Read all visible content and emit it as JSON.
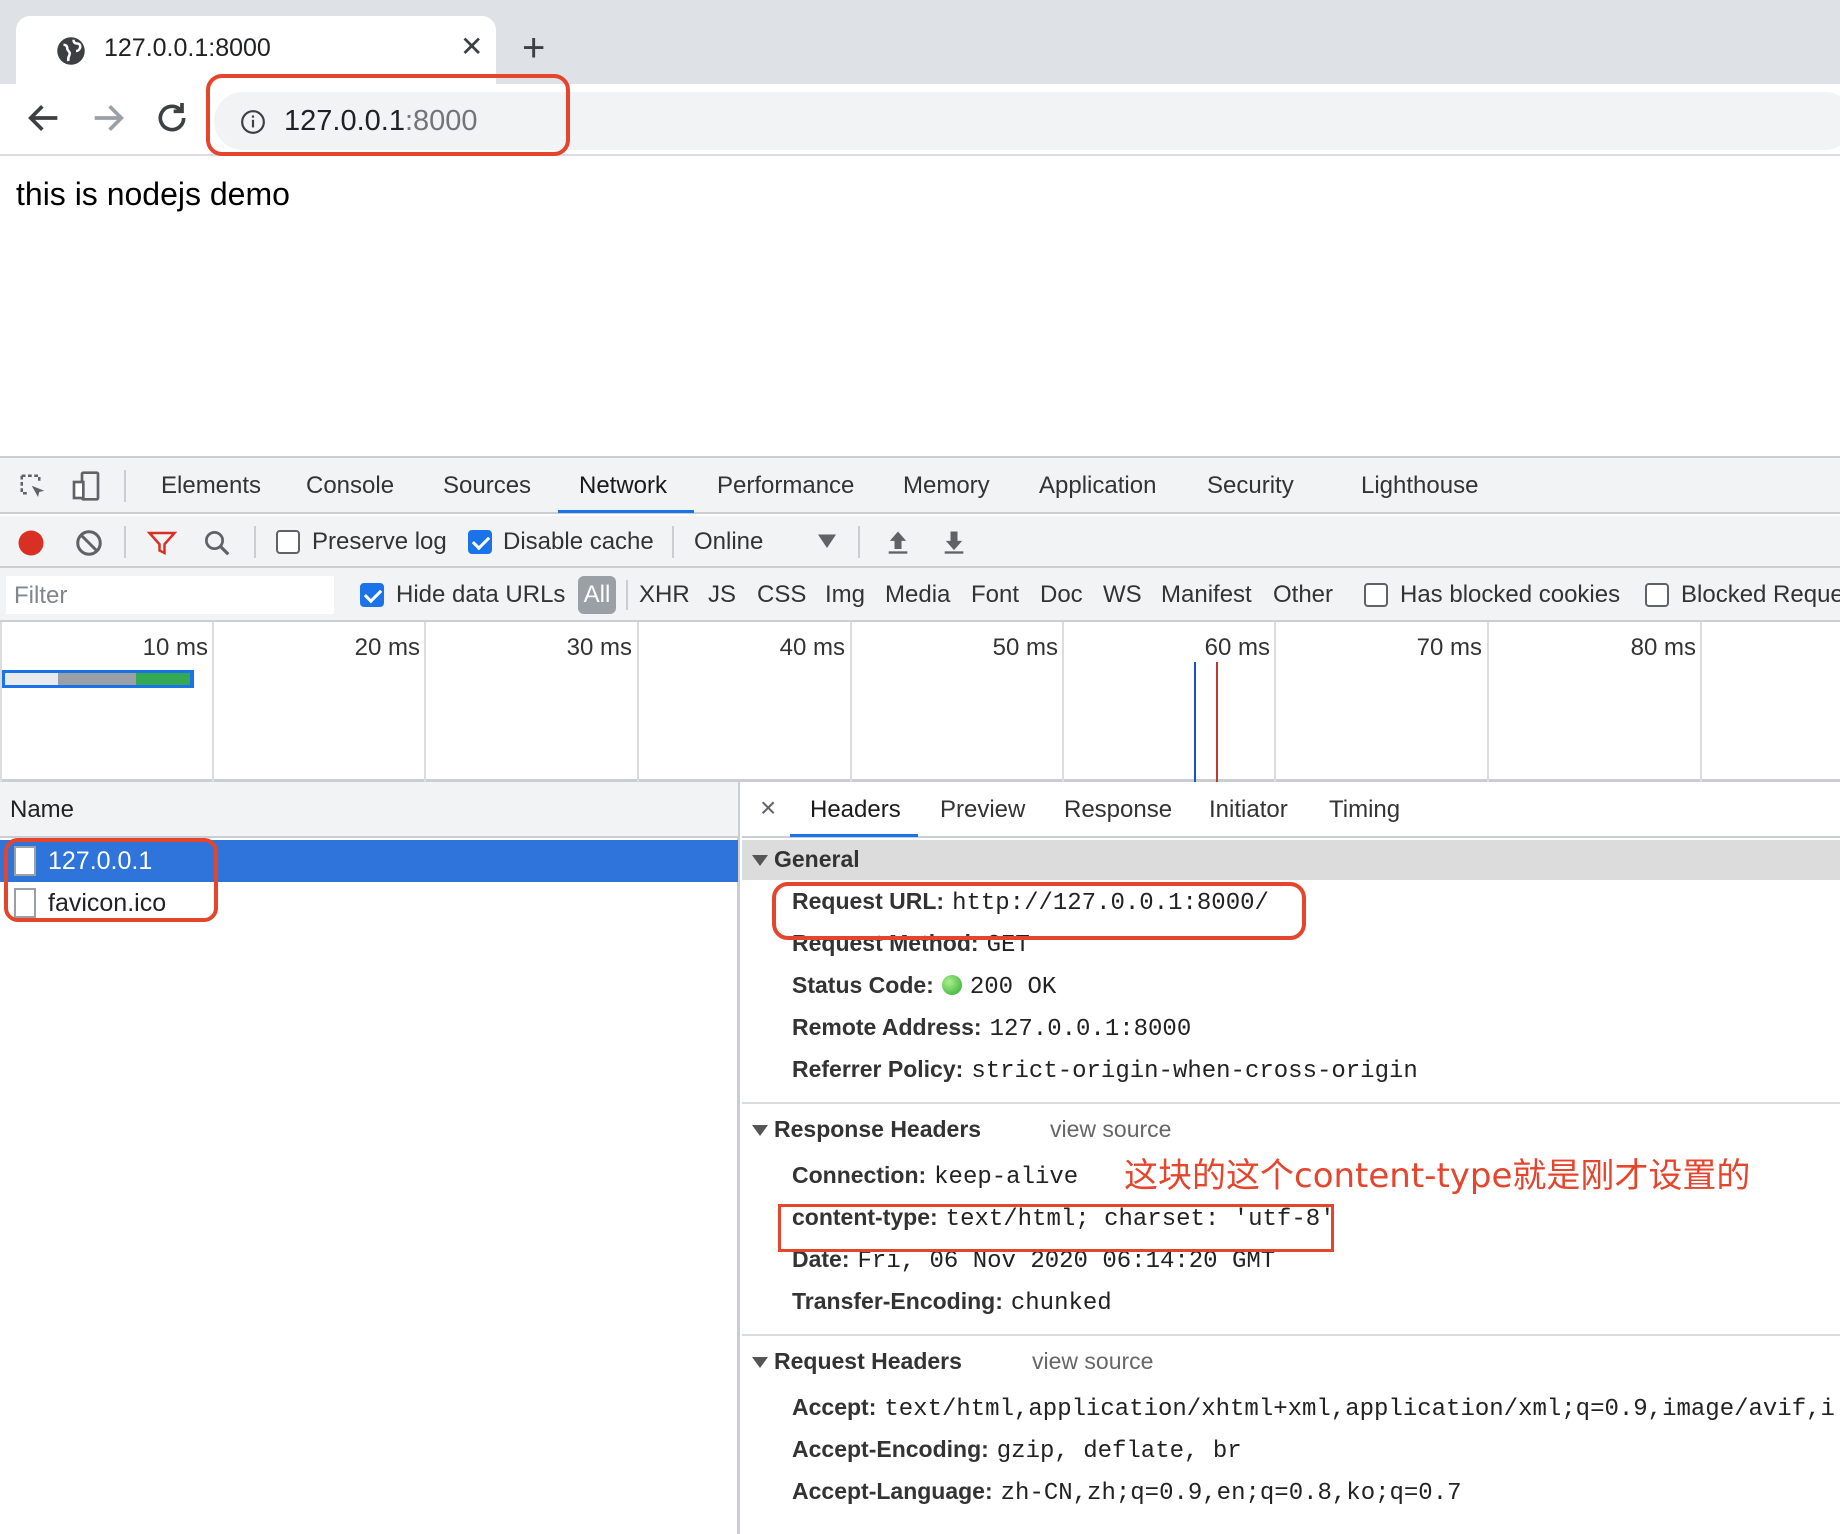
{
  "browser": {
    "tab_title": "127.0.0.1:8000",
    "url_host": "127.0.0.1",
    "url_port": ":8000"
  },
  "page": {
    "body_text": "this is nodejs demo"
  },
  "devtools": {
    "panels": [
      "Elements",
      "Console",
      "Sources",
      "Network",
      "Performance",
      "Memory",
      "Application",
      "Security",
      "Lighthouse"
    ],
    "active_panel": "Network",
    "toolbar": {
      "preserve_log": "Preserve log",
      "preserve_log_checked": false,
      "disable_cache": "Disable cache",
      "disable_cache_checked": true,
      "throttling": "Online"
    },
    "filter": {
      "placeholder": "Filter",
      "hide_data_urls": "Hide data URLs",
      "hide_data_urls_checked": true,
      "types": [
        "All",
        "XHR",
        "JS",
        "CSS",
        "Img",
        "Media",
        "Font",
        "Doc",
        "WS",
        "Manifest",
        "Other"
      ],
      "active_type": "All",
      "has_blocked_cookies": "Has blocked cookies",
      "blocked_requests": "Blocked Reque"
    },
    "timeline": {
      "ticks": [
        "10 ms",
        "20 ms",
        "30 ms",
        "40 ms",
        "50 ms",
        "60 ms",
        "70 ms",
        "80 ms"
      ],
      "colors": {
        "dom_content_loaded": "#1a4fd6",
        "load": "#c0392b",
        "bar_green": "#34a853",
        "bar_gray": "#9aa0a6"
      }
    },
    "requests": {
      "column_name": "Name",
      "rows": [
        {
          "name": "127.0.0.1",
          "selected": true
        },
        {
          "name": "favicon.ico",
          "selected": false
        }
      ]
    },
    "detail": {
      "tabs": [
        "Headers",
        "Preview",
        "Response",
        "Initiator",
        "Timing"
      ],
      "active_tab": "Headers",
      "general": {
        "title": "General",
        "rows": [
          {
            "k": "Request URL:",
            "v": "http://127.0.0.1:8000/"
          },
          {
            "k": "Request Method:",
            "v": "GET"
          },
          {
            "k": "Status Code:",
            "v": "200 OK"
          },
          {
            "k": "Remote Address:",
            "v": "127.0.0.1:8000"
          },
          {
            "k": "Referrer Policy:",
            "v": "strict-origin-when-cross-origin"
          }
        ]
      },
      "response_headers": {
        "title": "Response Headers",
        "view_source": "view source",
        "rows": [
          {
            "k": "Connection:",
            "v": "keep-alive"
          },
          {
            "k": "content-type:",
            "v": "text/html; charset: 'utf-8'"
          },
          {
            "k": "Date:",
            "v": "Fri, 06 Nov 2020 06:14:20 GMT"
          },
          {
            "k": "Transfer-Encoding:",
            "v": "chunked"
          }
        ]
      },
      "request_headers": {
        "title": "Request Headers",
        "view_source": "view source",
        "rows": [
          {
            "k": "Accept:",
            "v": "text/html,application/xhtml+xml,application/xml;q=0.9,image/avif,i"
          },
          {
            "k": "Accept-Encoding:",
            "v": "gzip, deflate, br"
          },
          {
            "k": "Accept-Language:",
            "v": "zh-CN,zh;q=0.9,en;q=0.8,ko;q=0.7"
          }
        ]
      }
    }
  },
  "annotation": {
    "text": "这块的这个content-type就是刚才设置的",
    "color": "#e5452d"
  }
}
